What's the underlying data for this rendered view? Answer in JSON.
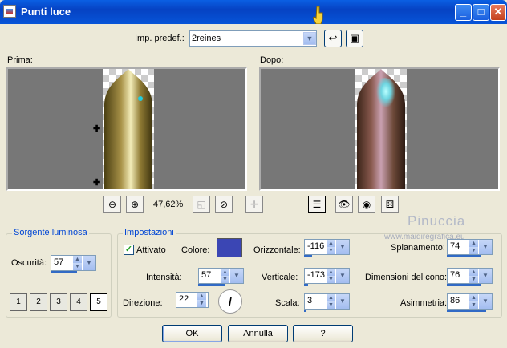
{
  "window": {
    "title": "Punti luce"
  },
  "presets": {
    "label": "Imp. predef.:",
    "value": "2reines"
  },
  "before": {
    "label": "Prima:"
  },
  "after": {
    "label": "Dopo:"
  },
  "zoom": {
    "value": "47,62%"
  },
  "watermark": {
    "name": "Pinuccia",
    "url": "www.maidiregrafica.eu"
  },
  "source_group": {
    "title": "Sorgente luminosa",
    "darkness_label": "Oscurità:",
    "darkness_value": "57",
    "preset_labels": [
      "1",
      "2",
      "3",
      "4",
      "5"
    ]
  },
  "settings_group": {
    "title": "Impostazioni",
    "enabled_label": "Attivato",
    "enabled": true,
    "color_label": "Colore:",
    "color": "#3b46b4",
    "intensity_label": "Intensità:",
    "intensity_value": "57",
    "direction_label": "Direzione:",
    "direction_value": "22",
    "horizontal_label": "Orizzontale:",
    "horizontal_value": "-116",
    "vertical_label": "Verticale:",
    "vertical_value": "-173",
    "scale_label": "Scala:",
    "scale_value": "3",
    "flatten_label": "Spianamento:",
    "flatten_value": "74",
    "cone_label": "Dimensioni del cono:",
    "cone_value": "76",
    "asym_label": "Asimmetria:",
    "asym_value": "86"
  },
  "buttons": {
    "ok": "OK",
    "cancel": "Annulla",
    "help": "?"
  }
}
